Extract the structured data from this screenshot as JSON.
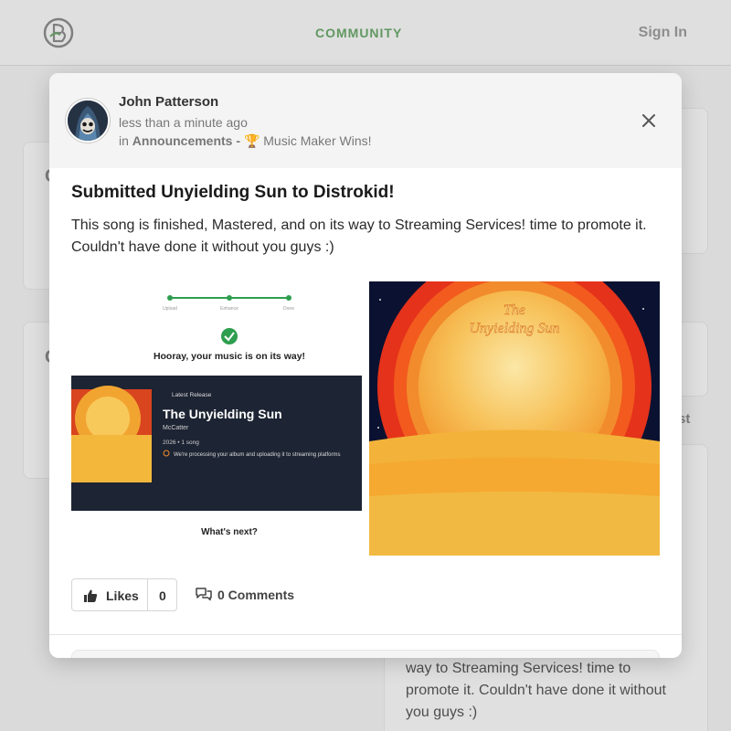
{
  "nav": {
    "community_label": "COMMUNITY",
    "signin_label": "Sign In"
  },
  "background": {
    "fragment_c1": "C",
    "fragment_c2": "C",
    "fragment_st": "st",
    "feed_text": "way to Streaming Services! time to promote it. Couldn't have done it without you guys :)"
  },
  "post": {
    "author": "John Patterson",
    "time": "less than a minute ago",
    "in_prefix": "in",
    "category": "Announcements",
    "separator": "-",
    "subcategory": "🏆 Music Maker Wins!",
    "title": "Submitted Unyielding Sun to Distrokid!",
    "body": "This song is finished, Mastered, and on its way to Streaming Services! time to promote it. Couldn't have done it without you guys :)",
    "likes_label": "Likes",
    "likes_count": "0",
    "comments_label": "0 Comments"
  },
  "screenshot_image": {
    "step_labels": [
      "Upload",
      "Enhance",
      "Done"
    ],
    "hooray": "Hooray, your music is on its way!",
    "latest_release": "Latest Release",
    "release_title": "The Unyielding Sun",
    "artist": "McCatter",
    "meta": "2026 • 1 song",
    "processing": "We're processing your album and uploading it to streaming platforms",
    "whats_next": "What's next?"
  },
  "cover_image": {
    "line1": "The",
    "line2": "Unyielding Sun"
  },
  "colors": {
    "accent_green": "#6aa56a",
    "check_green": "#2e9e4f"
  },
  "icons": {
    "close": "close-icon",
    "likes": "thumbs-up-icon",
    "comments": "comments-icon"
  }
}
